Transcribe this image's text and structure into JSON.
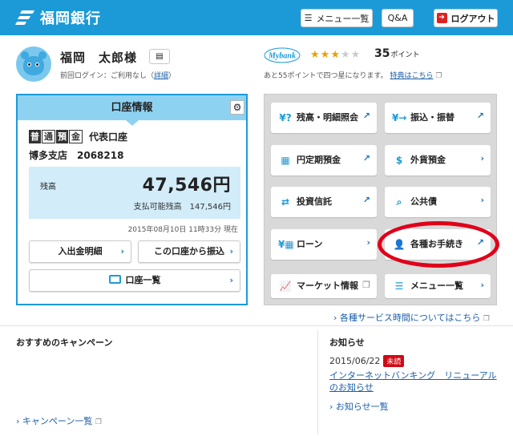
{
  "header": {
    "bank_name": "福岡銀行",
    "menu_button": "メニュー一覧",
    "qa_button": "Q&A",
    "logout_button": "ログアウト"
  },
  "profile": {
    "name": "福岡　太郎様",
    "last_login_prefix": "前回ログイン：ご利用なし（",
    "last_login_link": "詳細",
    "last_login_suffix": "）"
  },
  "mybank": {
    "logo_text": "Mybank",
    "stars_filled": 3,
    "stars_total": 5,
    "points_value": "35",
    "points_unit": "ポイント",
    "note": "あと55ポイントで四つ星になります。",
    "note_link": "特典はこちら"
  },
  "account": {
    "panel_title": "口座情報",
    "type_chars": [
      "普",
      "通",
      "預",
      "金"
    ],
    "type_label": "代表口座",
    "branch": "博多支店　2068218",
    "balance_label": "残高",
    "balance": "47,546円",
    "available": "支払可能残高　147,546円",
    "as_of": "2015年08月10日 11時33分 現在",
    "btn_history": "入出金明細",
    "btn_transfer": "この口座から振込",
    "btn_list": "口座一覧"
  },
  "menu": {
    "items": [
      {
        "label": "残高・明細照会",
        "icon": "yen-search-icon"
      },
      {
        "label": "振込・振替",
        "icon": "yen-transfer-icon"
      },
      {
        "label": "円定期預金",
        "icon": "calendar-yen-icon"
      },
      {
        "label": "外貨預金",
        "icon": "dollar-coin-icon"
      },
      {
        "label": "投資信託",
        "icon": "investment-icon"
      },
      {
        "label": "公共債",
        "icon": "bond-icon"
      },
      {
        "label": "ローン",
        "icon": "loan-calculator-icon"
      },
      {
        "label": "各種お手続き",
        "icon": "person-icon"
      },
      {
        "label": "マーケット情報",
        "icon": "chart-icon"
      },
      {
        "label": "メニュー一覧",
        "icon": "menu-icon"
      }
    ]
  },
  "service_time_link": "各種サービス時間についてはこちら",
  "campaign": {
    "title": "おすすめのキャンペーン",
    "link": "キャンペーン一覧"
  },
  "news": {
    "title": "お知らせ",
    "date": "2015/06/22",
    "badge": "未読",
    "item": "インターネットバンキング　リニューアルのお知らせ",
    "link": "お知らせ一覧"
  }
}
